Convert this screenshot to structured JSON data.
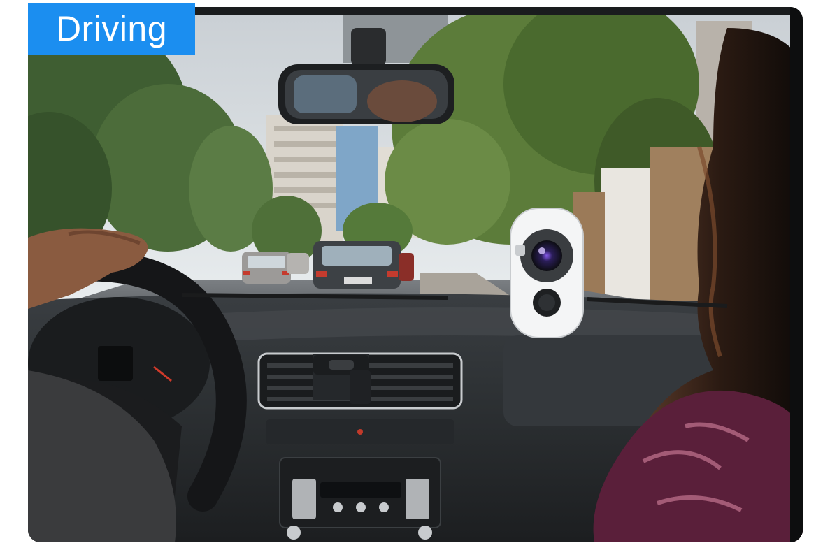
{
  "badge": {
    "label": "Driving",
    "color": "#1b8ef0"
  },
  "photo": {
    "subject": "car-interior-with-camera-on-dashboard"
  }
}
